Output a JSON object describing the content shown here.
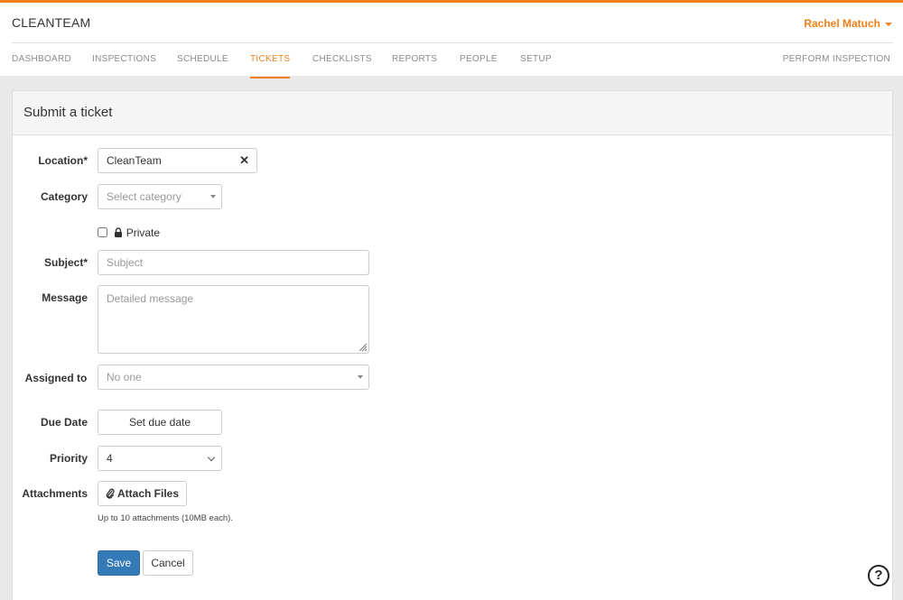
{
  "app": {
    "brand": "CLEANTEAM",
    "user_name": "Rachel Matuch"
  },
  "nav": {
    "items": [
      "DASHBOARD",
      "INSPECTIONS",
      "SCHEDULE",
      "TICKETS",
      "CHECKLISTS",
      "REPORTS",
      "PEOPLE",
      "SETUP"
    ],
    "active": "TICKETS",
    "perform": "PERFORM INSPECTION"
  },
  "form": {
    "title": "Submit a ticket",
    "location": {
      "label": "Location*",
      "value": "CleanTeam"
    },
    "category": {
      "label": "Category",
      "placeholder": "Select category"
    },
    "private_label": "Private",
    "subject": {
      "label": "Subject*",
      "placeholder": "Subject"
    },
    "message": {
      "label": "Message",
      "placeholder": "Detailed message"
    },
    "assigned": {
      "label": "Assigned to",
      "value": "No one"
    },
    "due_date": {
      "label": "Due Date",
      "button": "Set due date"
    },
    "priority": {
      "label": "Priority",
      "value": "4"
    },
    "attachments": {
      "label": "Attachments",
      "button": "Attach Files",
      "hint": "Up to 10 attachments (10MB each)."
    },
    "save": "Save",
    "cancel": "Cancel"
  },
  "help": "?",
  "colors": {
    "accent": "#f07f1a",
    "primary": "#337ab7"
  }
}
